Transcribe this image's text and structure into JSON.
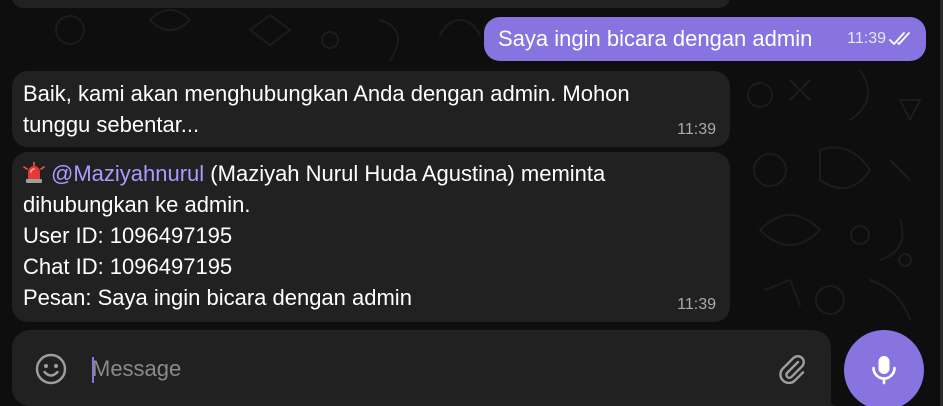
{
  "theme": {
    "accent": "#8774e1",
    "bubble_incoming": "#212121",
    "background": "#0e0e0e"
  },
  "messages": [
    {
      "direction": "outgoing",
      "text": "Saya ingin bicara dengan admin",
      "time": "11:39",
      "status_icon": "double-check-icon"
    },
    {
      "direction": "incoming",
      "lines": [
        "Baik, kami akan menghubungkan Anda dengan admin. Mohon",
        "tunggu sebentar..."
      ],
      "time": "11:39"
    },
    {
      "direction": "incoming",
      "emoji_icon": "police-siren-icon",
      "mention": "@Maziyahnurul",
      "line1_rest": " (Maziyah Nurul Huda Agustina) meminta",
      "line2": "dihubungkan ke admin.",
      "line3": "User ID: 1096497195",
      "line4": "Chat ID: 1096497195",
      "line5": "Pesan: Saya ingin bicara dengan admin",
      "time": "11:39"
    }
  ],
  "composer": {
    "placeholder": "Message",
    "value": "",
    "emoji_icon": "smiley-icon",
    "attach_icon": "paperclip-icon",
    "send_icon": "microphone-icon"
  }
}
